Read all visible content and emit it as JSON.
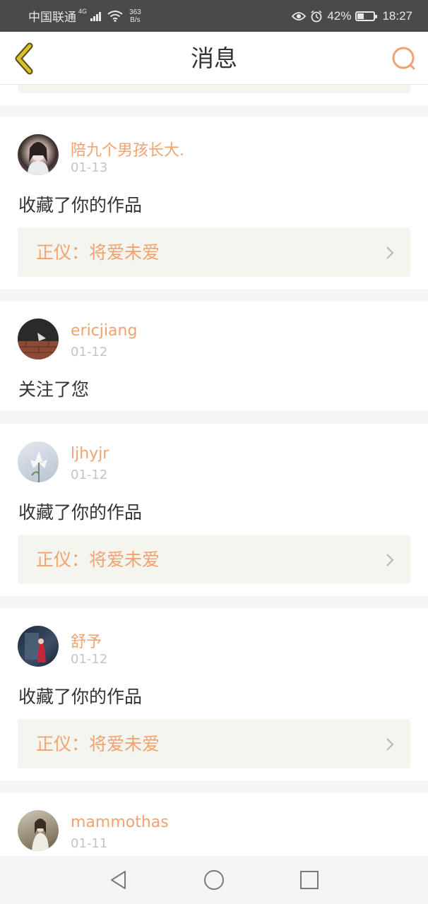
{
  "status_bar": {
    "carrier": "中国联通",
    "network": "4G",
    "speed_value": "363",
    "speed_unit": "B/s",
    "battery": "42%",
    "battery_level": 0.42,
    "time": "18:27"
  },
  "header": {
    "title": "消息",
    "back_icon": "chevron-left-icon",
    "search_icon": "search-icon"
  },
  "colors": {
    "accent": "#f0a271",
    "back": "#d8c22a",
    "text": "#333333",
    "muted": "#c4c4c4",
    "card_bg": "#f5f5ef"
  },
  "messages": [
    {
      "username": "陪九个男孩长大.",
      "date": "01-13",
      "action": "收藏了你的作品",
      "work": "正仪：将爱未爱"
    },
    {
      "username": "ericjiang",
      "date": "01-12",
      "action": "关注了您"
    },
    {
      "username": "ljhyjr",
      "date": "01-12",
      "action": "收藏了你的作品",
      "work": "正仪：将爱未爱"
    },
    {
      "username": "舒予",
      "date": "01-12",
      "action": "收藏了你的作品",
      "work": "正仪：将爱未爱"
    },
    {
      "username": "mammothas",
      "date": "01-11"
    }
  ],
  "nav_bar": {
    "back": "triangle-back-icon",
    "home": "circle-home-icon",
    "recents": "square-recents-icon"
  }
}
